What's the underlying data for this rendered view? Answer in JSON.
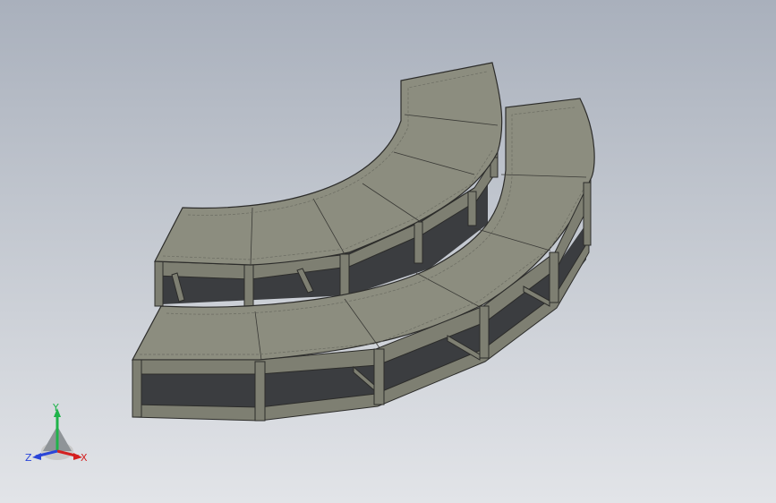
{
  "viewport": {
    "model": "curved-two-tier-platform-frame",
    "colors": {
      "background_top": "#a9b0bc",
      "background_bottom": "#e2e4e8",
      "deck_fill": "#8c8d7f",
      "frame_fill": "#7e7f72",
      "edge": "#2c2c2a",
      "hollow": "#3b3d40"
    }
  },
  "triad": {
    "x_label": "X",
    "y_label": "Y",
    "z_label": "Z",
    "x_color": "#d42020",
    "y_color": "#1fb34a",
    "z_color": "#2a45d8"
  }
}
